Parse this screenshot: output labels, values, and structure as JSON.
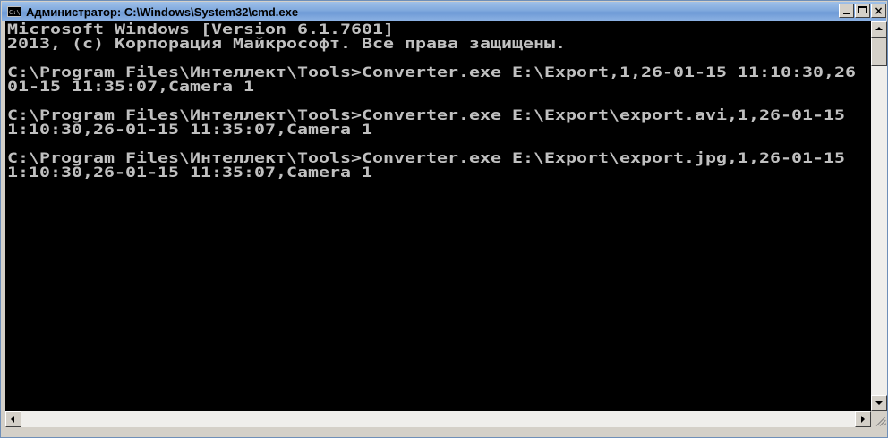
{
  "window": {
    "title": "Администратор: C:\\Windows\\System32\\cmd.exe",
    "icon_glyph": "C:\\.",
    "icon_name": "cmd-app-icon"
  },
  "controls": {
    "minimize": "minimize",
    "maximize": "maximize",
    "close_glyph": "×"
  },
  "console": {
    "lines": [
      "Microsoft Windows [Version 6.1.7601]",
      "2013, (c) Корпорация Майкрософт. Все права защищены.",
      "",
      "C:\\Program Files\\Интеллект\\Tools>Converter.exe E:\\Export,1,26-01-15 11:10:30,26",
      "01-15 11:35:07,Camera 1",
      "",
      "C:\\Program Files\\Интеллект\\Tools>Converter.exe E:\\Export\\export.avi,1,26-01-15",
      "1:10:30,26-01-15 11:35:07,Camera 1",
      "",
      "C:\\Program Files\\Интеллект\\Tools>Converter.exe E:\\Export\\export.jpg,1,26-01-15",
      "1:10:30,26-01-15 11:35:07,Camera 1"
    ]
  },
  "colors": {
    "console_bg": "#000000",
    "console_text": "#c0c0c0",
    "titlebar": "#7fa8dd"
  }
}
